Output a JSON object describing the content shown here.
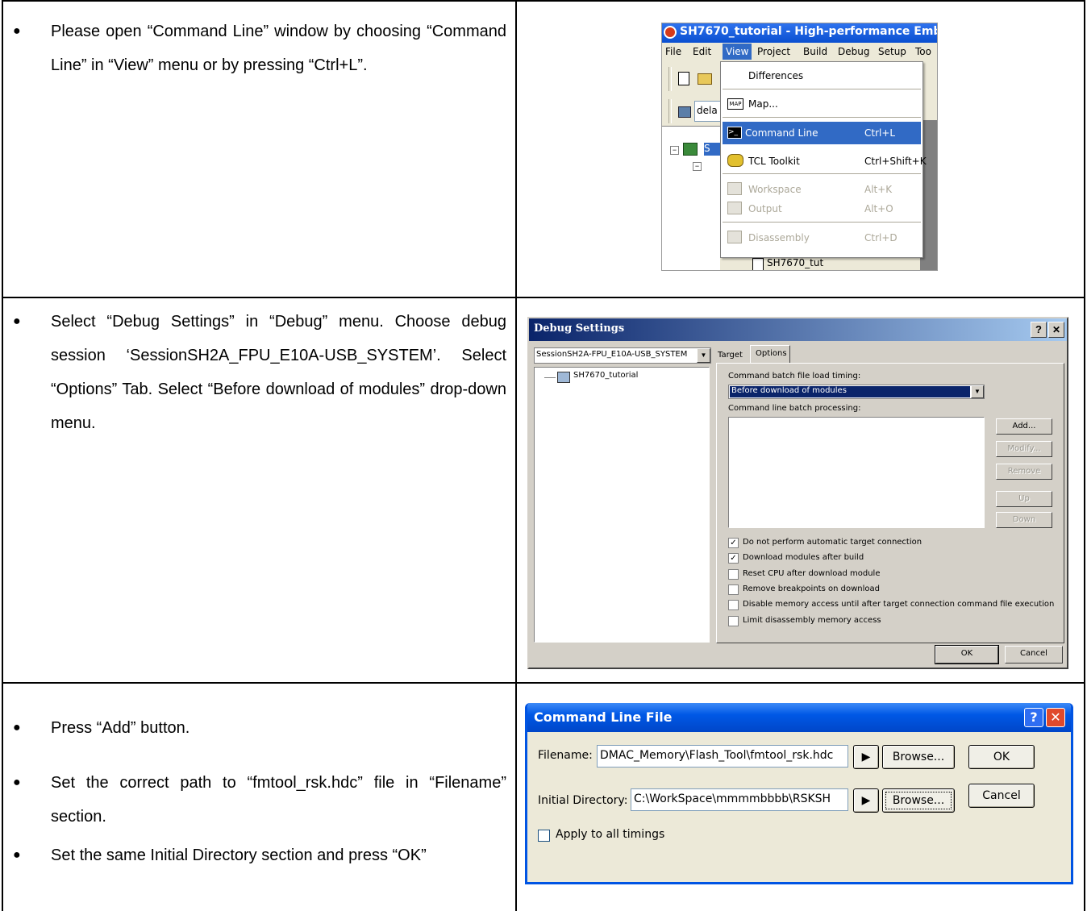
{
  "rows": [
    {
      "instructions": [
        "Please open “Command Line” window by choosing “Command Line” in “View” menu or by pressing “Ctrl+L”."
      ]
    },
    {
      "instructions": [
        "Select “Debug Settings” in “Debug” menu. Choose debug session ‘SessionSH2A_FPU_E10A-USB_SYSTEM’. Select “Options” Tab. Select “Before download of modules” drop-down menu."
      ]
    },
    {
      "instructions": [
        "Press “Add” button.",
        "Set the correct path to “fmtool_rsk.hdc” file in “Filename” section.",
        "Set the same Initial Directory section and press “OK”"
      ]
    }
  ],
  "view_menu_shot": {
    "title": "SH7670_tutorial - High-performance Emb",
    "menubar": [
      "File",
      "Edit",
      "View",
      "Project",
      "Build",
      "Debug",
      "Setup",
      "Too"
    ],
    "toolbar_partial_text": "dela",
    "items": [
      {
        "label": "Differences",
        "shortcut": "",
        "state": "normal",
        "icon": "none"
      },
      {
        "label": "Map...",
        "shortcut": "",
        "state": "normal",
        "icon": "map-icon"
      },
      {
        "label": "Command Line",
        "shortcut": "Ctrl+L",
        "state": "highlighted",
        "icon": "command-line-icon"
      },
      {
        "label": "TCL Toolkit",
        "shortcut": "Ctrl+Shift+K",
        "state": "normal",
        "icon": "tcl-icon"
      },
      {
        "label": "Workspace",
        "shortcut": "Alt+K",
        "state": "disabled",
        "icon": "workspace-icon"
      },
      {
        "label": "Output",
        "shortcut": "Alt+O",
        "state": "disabled",
        "icon": "output-icon"
      },
      {
        "label": "Disassembly",
        "shortcut": "Ctrl+D",
        "state": "disabled",
        "icon": "disassembly-icon"
      }
    ],
    "tree_partial_text": "S",
    "tree_bottom_item": "SH7670_tut",
    "highlight_color": "#316ac5"
  },
  "debug_settings": {
    "title": "Debug Settings",
    "help_btn": "?",
    "close_btn": "✕",
    "session": "SessionSH2A-FPU_E10A-USB_SYSTEM",
    "tree_item": "SH7670_tutorial",
    "tabs": [
      "Target",
      "Options"
    ],
    "batch_timing_label": "Command batch file load timing:",
    "batch_timing_value": "Before download of modules",
    "batch_processing_label": "Command line batch processing:",
    "buttons": [
      {
        "label": "Add...",
        "enabled": true
      },
      {
        "label": "Modify...",
        "enabled": false
      },
      {
        "label": "Remove",
        "enabled": false
      },
      {
        "label": "Up",
        "enabled": false
      },
      {
        "label": "Down",
        "enabled": false
      }
    ],
    "checkboxes": [
      {
        "label": "Do not perform automatic target connection",
        "checked": true
      },
      {
        "label": "Download modules after build",
        "checked": true
      },
      {
        "label": "Reset CPU after download module",
        "checked": false
      },
      {
        "label": "Remove breakpoints on download",
        "checked": false
      },
      {
        "label": "Disable memory access until after target connection command file execution",
        "checked": false
      },
      {
        "label": "Limit disassembly memory access",
        "checked": false
      }
    ],
    "ok": "OK",
    "cancel": "Cancel",
    "title_bar_color": "#0a246a"
  },
  "command_line_file": {
    "title": "Command Line File",
    "filename_label": "Filename:",
    "filename_value": "DMAC_Memory\\Flash_Tool\\fmtool_rsk.hdc",
    "initdir_label": "Initial Directory:",
    "initdir_value": "C:\\WorkSpace\\mmmmbbbb\\RSKSH",
    "browse": "Browse...",
    "ok": "OK",
    "cancel": "Cancel",
    "apply_all": "Apply to all timings",
    "title_bar_color": "#0054e3"
  }
}
